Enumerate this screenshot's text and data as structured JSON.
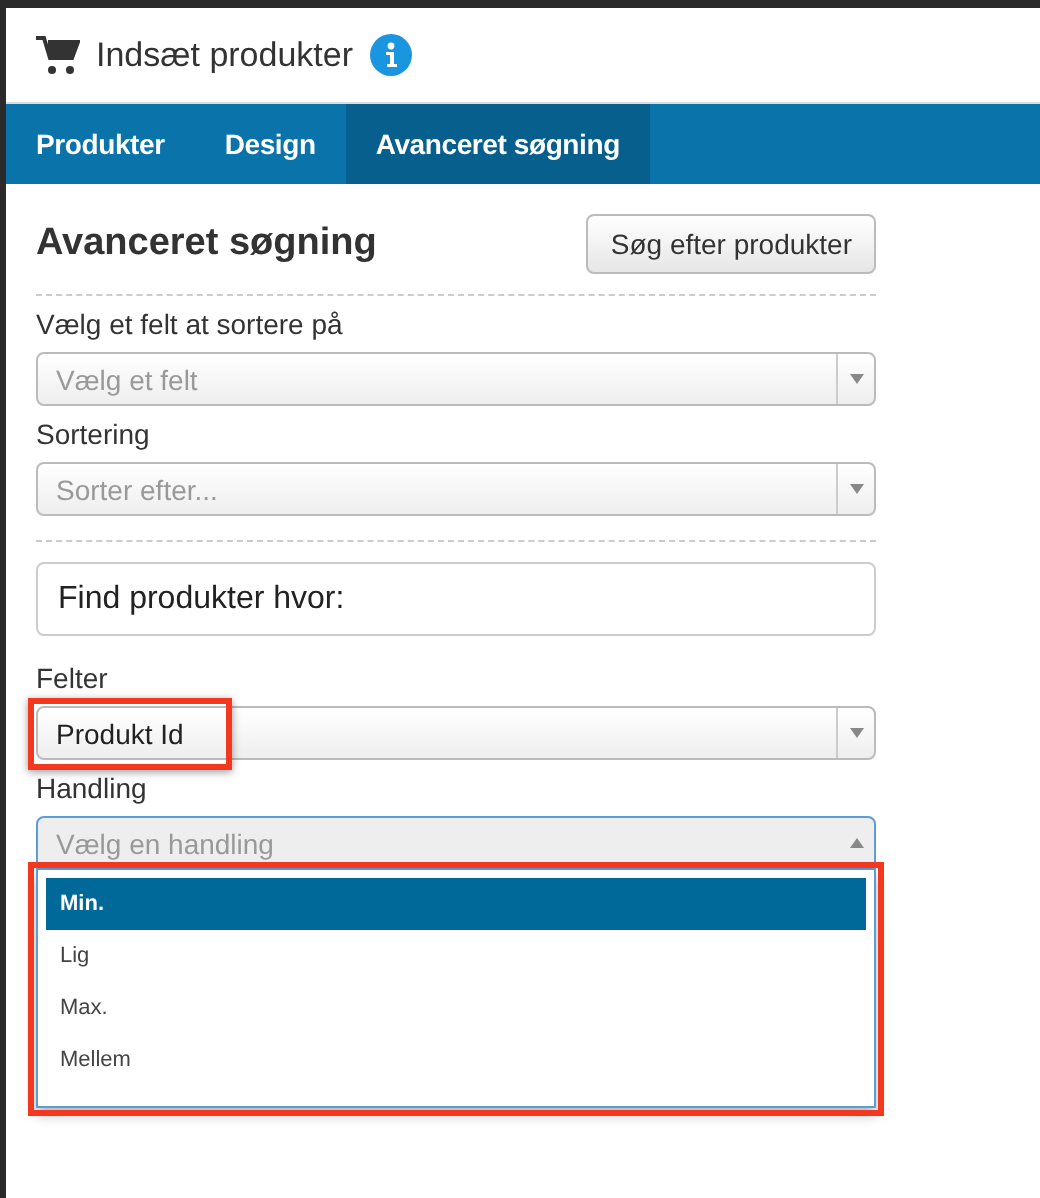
{
  "window": {
    "title": "Indsæt produkter"
  },
  "tabs": [
    {
      "label": "Produkter",
      "selected": false
    },
    {
      "label": "Design",
      "selected": false
    },
    {
      "label": "Avanceret søgning",
      "selected": true
    }
  ],
  "heading": "Avanceret søgning",
  "search_button": "Søg efter produkter",
  "sort_field": {
    "label": "Vælg et felt at sortere på",
    "placeholder": "Vælg et felt"
  },
  "sort_order": {
    "label": "Sortering",
    "placeholder": "Sorter efter..."
  },
  "criteria_title": "Find produkter hvor:",
  "fields": {
    "label": "Felter",
    "value": "Produkt Id",
    "highlighted": true
  },
  "action": {
    "label": "Handling",
    "placeholder": "Vælg en handling",
    "expanded": true,
    "highlighted": true,
    "options": [
      {
        "label": "Min.",
        "selected": true
      },
      {
        "label": "Lig",
        "selected": false
      },
      {
        "label": "Max.",
        "selected": false
      },
      {
        "label": "Mellem",
        "selected": false
      }
    ]
  }
}
